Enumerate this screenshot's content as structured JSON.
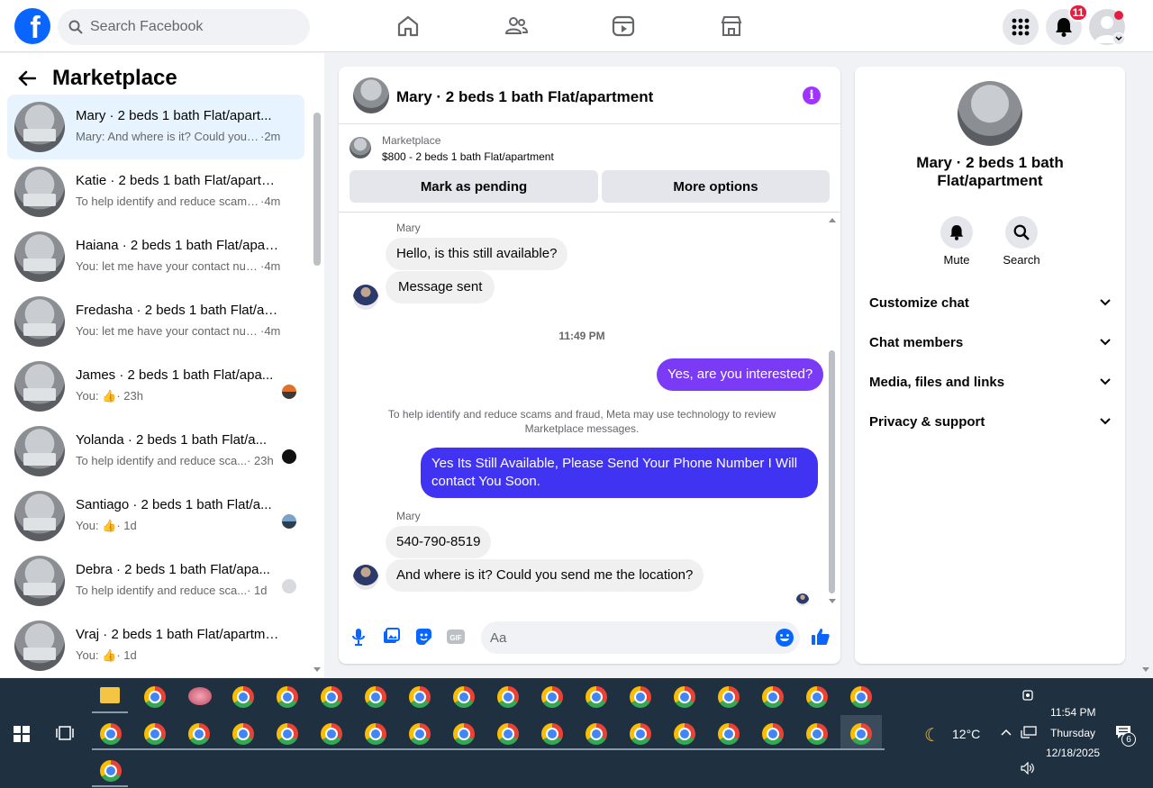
{
  "topbar": {
    "search_placeholder": "Search Facebook",
    "notification_count": "11"
  },
  "sidebar": {
    "title": "Marketplace",
    "conversations": [
      {
        "name": "Mary · 2 beds 1 bath Flat/apart...",
        "preview": "Mary: And where is it? Could you s...",
        "time": "·2m",
        "active": true
      },
      {
        "name": "Katie · 2 beds 1 bath Flat/apartm...",
        "preview": "To help identify and reduce scams ...",
        "time": "·4m"
      },
      {
        "name": "Haiana · 2 beds 1 bath Flat/apart...",
        "preview": "You: let me have your contact num...",
        "time": "·4m"
      },
      {
        "name": "Fredasha · 2 beds 1 bath Flat/ap...",
        "preview": "You: let me have your contact num...",
        "time": "·4m"
      },
      {
        "name": "James · 2 beds 1 bath Flat/apa...",
        "preview": "You: 👍",
        "time": "· 23h"
      },
      {
        "name": "Yolanda · 2 beds 1 bath Flat/a...",
        "preview": "To help identify and reduce sca...",
        "time": "· 23h"
      },
      {
        "name": "Santiago · 2 beds 1 bath Flat/a...",
        "preview": "You: 👍",
        "time": "· 1d"
      },
      {
        "name": "Debra · 2 beds 1 bath Flat/apa...",
        "preview": "To help identify and reduce sca...",
        "time": "· 1d"
      },
      {
        "name": "Vraj · 2 beds 1 bath Flat/apartme...",
        "preview": "You: 👍",
        "time": "· 1d"
      }
    ]
  },
  "chat": {
    "title": "Mary · 2 beds 1 bath Flat/apartment",
    "listing_label": "Marketplace",
    "listing_price": "$800 - 2 beds 1 bath Flat/apartment",
    "mark_pending": "Mark as pending",
    "more_options": "More options",
    "sender_name": "Mary",
    "msg1": "Hello, is this still available?",
    "msg2": "Message sent",
    "timestamp": "11:49 PM",
    "msg3": "Yes, are you interested?",
    "notice": "To help identify and reduce scams and fraud, Meta may use technology to review Marketplace messages.",
    "msg4": "Yes Its Still Available, Please Send Your Phone Number I Will contact You Soon.",
    "msg5": "540-790-8519",
    "msg6": "And where is it? Could you send me the location?",
    "input_placeholder": "Aa"
  },
  "details": {
    "title": "Mary · 2 beds 1 bath Flat/apartment",
    "mute": "Mute",
    "search": "Search",
    "rows": [
      "Customize chat",
      "Chat members",
      "Media, files and links",
      "Privacy & support"
    ]
  },
  "taskbar": {
    "weather": "12°C",
    "time": "11:54 PM",
    "day": "Thursday",
    "date": "12/18/2025",
    "notifications": "6"
  },
  "colors": {
    "brand": "#0866ff",
    "outgoing": "#7b3af5",
    "outgoing_long": "#4034f2"
  }
}
